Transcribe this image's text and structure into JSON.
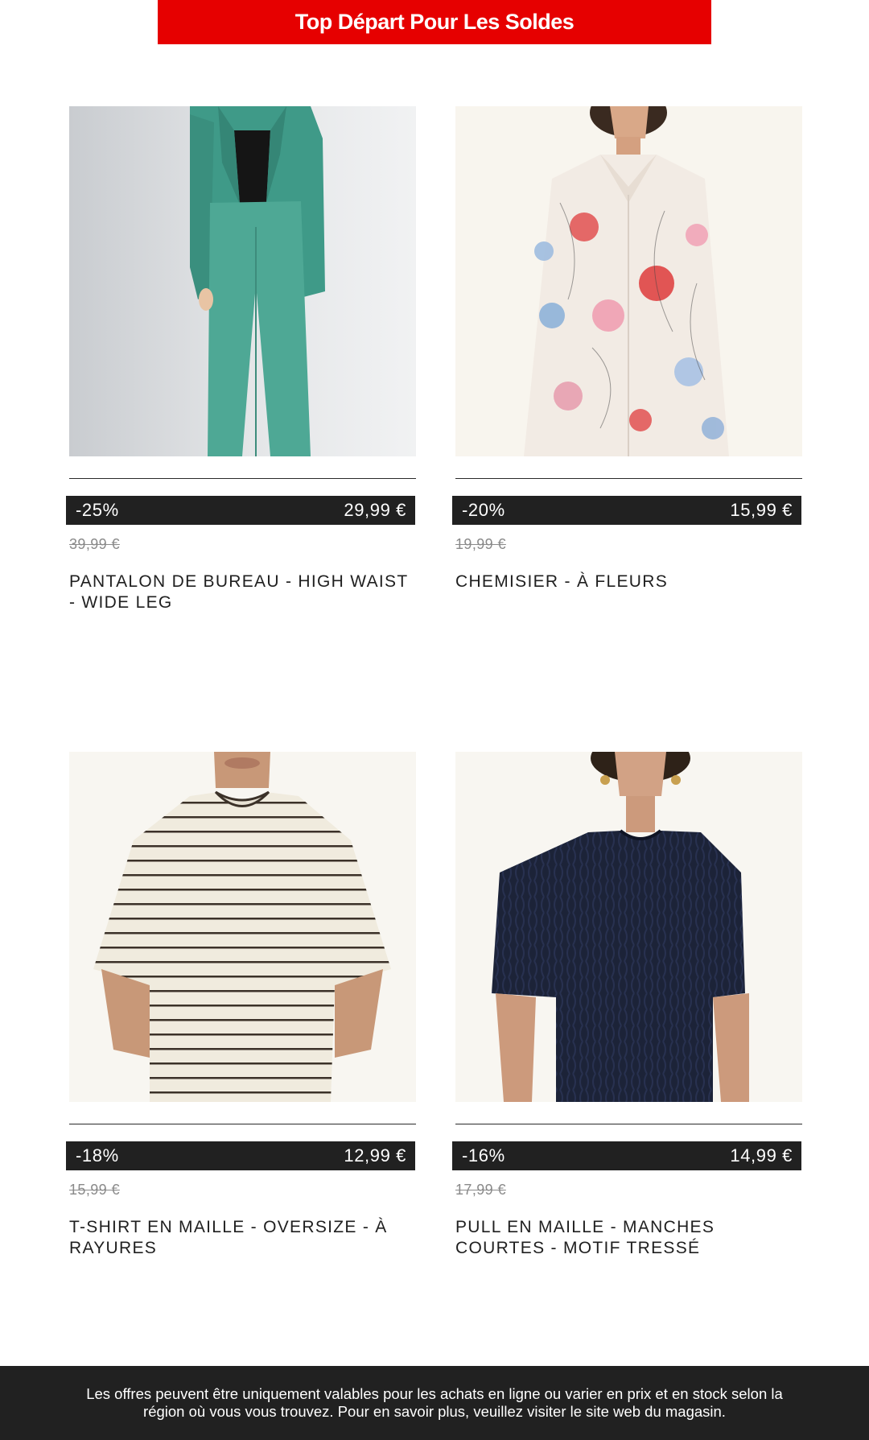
{
  "banner": {
    "label": "Top Départ Pour Les Soldes"
  },
  "products": [
    {
      "discount": "-25%",
      "price": "29,99 €",
      "old_price": "39,99 €",
      "name": "PANTALON DE BUREAU - HIGH WAIST - WIDE LEG",
      "image": "green-suit-pants-photo"
    },
    {
      "discount": "-20%",
      "price": "15,99 €",
      "old_price": "19,99 €",
      "name": "CHEMISIER - À FLEURS",
      "image": "floral-blouse-photo"
    },
    {
      "discount": "-18%",
      "price": "12,99 €",
      "old_price": "15,99 €",
      "name": "T-SHIRT EN MAILLE - OVERSIZE - À RAYURES",
      "image": "striped-tshirt-photo"
    },
    {
      "discount": "-16%",
      "price": "14,99 €",
      "old_price": "17,99 €",
      "name": "PULL EN MAILLE - MANCHES COURTES - MOTIF TRESSÉ",
      "image": "navy-knit-sweater-photo"
    }
  ],
  "footer": {
    "disclaimer": "Les offres peuvent être uniquement valables pour les achats en ligne ou varier en prix et en stock selon la région où vous vous trouvez. Pour en savoir plus, veuillez visiter le site web du magasin."
  },
  "colors": {
    "banner": "#e60000",
    "price_bar": "#212121",
    "footer": "#212121",
    "old_price": "#8a8a8a"
  }
}
